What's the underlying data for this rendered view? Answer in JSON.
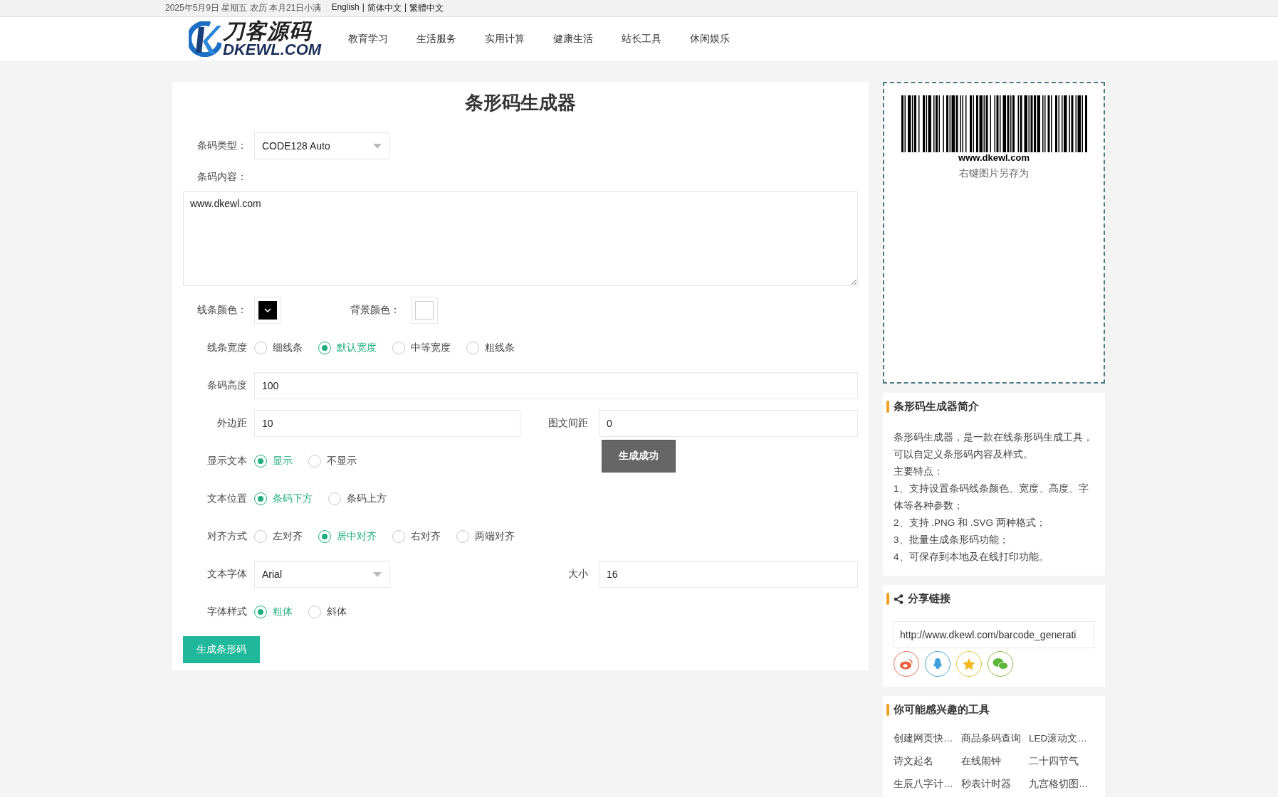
{
  "topbar": {
    "date": "2025年5月9日 星期五 农历 本月21日小满",
    "separator": "|",
    "languages": [
      "English",
      "简体中文",
      "繁體中文"
    ]
  },
  "header": {
    "logo": {
      "name": "刀客源码",
      "domain": "DKEWL.COM"
    },
    "nav": [
      "教育学习",
      "生活服务",
      "实用计算",
      "健康生活",
      "站长工具",
      "休闲娱乐"
    ]
  },
  "form": {
    "title": "条形码生成器",
    "rows": [
      {
        "kind": "select",
        "label": "条码类型：",
        "value": "CODE128 Auto"
      },
      {
        "kind": "textarea",
        "label": "条码内容：",
        "value": "www.dkewl.com"
      },
      {
        "kind": "colors",
        "items": [
          {
            "label": "线条颜色：",
            "color": "#000000"
          },
          {
            "label": "背景颜色：",
            "color": "#ffffff"
          }
        ]
      },
      {
        "kind": "radio",
        "label": "线条宽度",
        "options": [
          {
            "label": "细线条",
            "selected": false
          },
          {
            "label": "默认宽度",
            "selected": true
          },
          {
            "label": "中等宽度",
            "selected": false
          },
          {
            "label": "粗线条",
            "selected": false
          }
        ]
      },
      {
        "kind": "input",
        "label": "条码高度",
        "value": "100"
      },
      {
        "kind": "pair",
        "items": [
          {
            "kind": "input",
            "label": "外边距",
            "value": "10"
          },
          {
            "kind": "input",
            "label": "图文间距",
            "value": "0"
          }
        ]
      },
      {
        "kind": "radio",
        "label": "显示文本",
        "options": [
          {
            "label": "显示",
            "selected": true
          },
          {
            "label": "不显示",
            "selected": false
          }
        ]
      },
      {
        "kind": "radio",
        "label": "文本位置",
        "options": [
          {
            "label": "条码下方",
            "selected": true
          },
          {
            "label": "条码上方",
            "selected": false
          }
        ]
      },
      {
        "kind": "radio",
        "label": "对齐方式",
        "options": [
          {
            "label": "左对齐",
            "selected": false
          },
          {
            "label": "居中对齐",
            "selected": true
          },
          {
            "label": "右对齐",
            "selected": false
          },
          {
            "label": "两端对齐",
            "selected": false
          }
        ]
      },
      {
        "kind": "pair",
        "items": [
          {
            "kind": "select",
            "label": "文本字体",
            "value": "Arial"
          },
          {
            "kind": "input",
            "label": "大小",
            "value": "16"
          }
        ]
      },
      {
        "kind": "radio",
        "label": "字体样式",
        "options": [
          {
            "label": "粗体",
            "selected": true
          },
          {
            "label": "斜体",
            "selected": false
          }
        ]
      }
    ],
    "button": "生成条形码",
    "toast": "生成成功"
  },
  "preview": {
    "caption": "www.dkewl.com",
    "hint": "右键图片另存为"
  },
  "intro": {
    "title": "条形码生成器简介",
    "paragraphs": [
      "条形码生成器，是一款在线条形码生成工具，可以自定义条形码内容及样式。",
      "主要特点：",
      "1、支持设置条码线条颜色、宽度、高度、字体等各种参数；",
      "2、支持 .PNG 和 .SVG 两种格式；",
      "3、批量生成条形码功能；",
      "4、可保存到本地及在线打印功能。"
    ]
  },
  "share": {
    "title": "分享链接",
    "url": "http://www.dkewl.com/barcode_generati",
    "buttons": [
      {
        "kind": "weibo"
      },
      {
        "kind": "qq"
      },
      {
        "kind": "qzone"
      },
      {
        "kind": "wechat"
      }
    ]
  },
  "tools": {
    "title": "你可能感兴趣的工具",
    "items": [
      "创建网页快…",
      "商品条码查询",
      "LED滚动文…",
      "诗文起名",
      "在线闹钟",
      "二十四节气",
      "生辰八字计…",
      "秒表计时器",
      "九宫格切图…"
    ]
  }
}
